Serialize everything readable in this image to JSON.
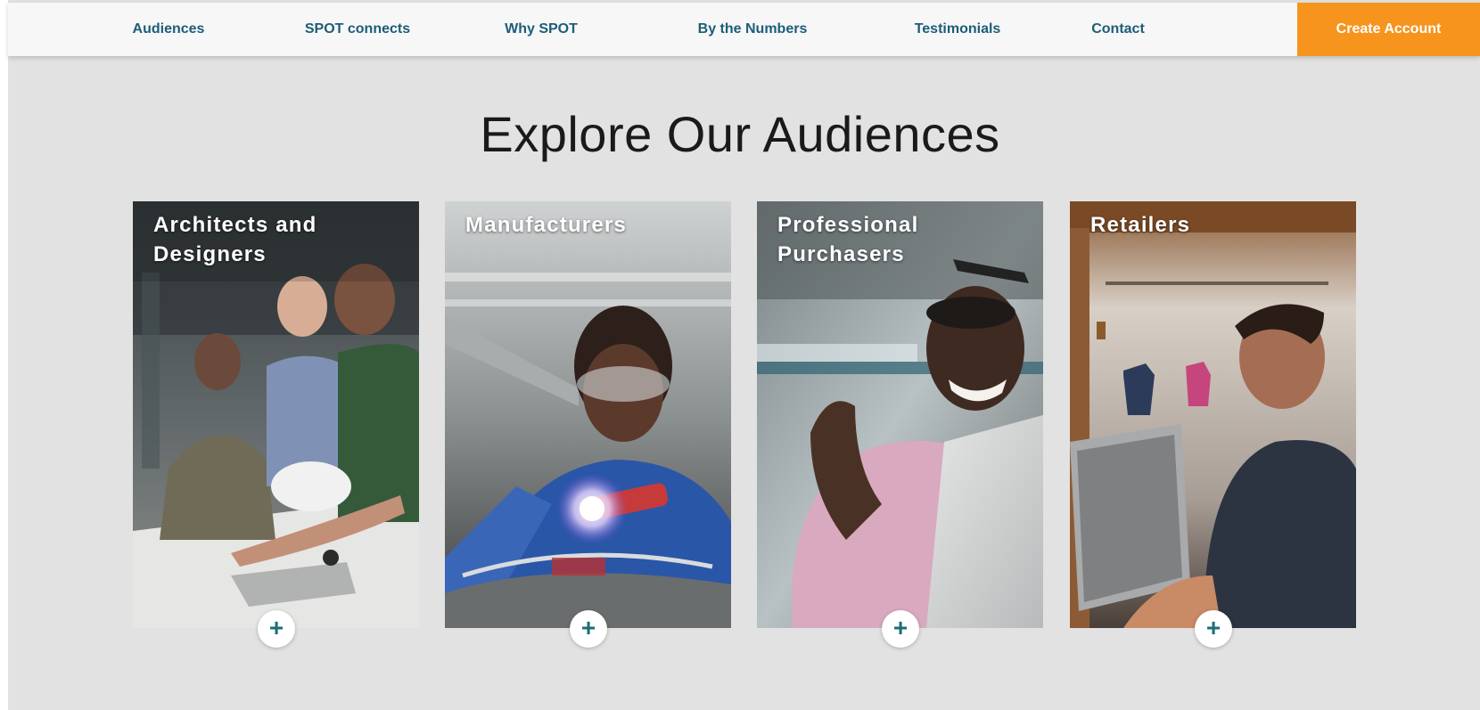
{
  "nav": {
    "items": [
      {
        "label": "Audiences"
      },
      {
        "label": "SPOT connects"
      },
      {
        "label": "Why SPOT"
      },
      {
        "label": "By the Numbers"
      },
      {
        "label": "Testimonials"
      },
      {
        "label": "Contact"
      }
    ],
    "cta_label": "Create Account"
  },
  "section": {
    "title": "Explore Our Audiences"
  },
  "cards": [
    {
      "label": "Architects and Designers",
      "expand_icon": "+"
    },
    {
      "label": "Manufacturers",
      "expand_icon": "+"
    },
    {
      "label": "Professional Purchasers",
      "expand_icon": "+"
    },
    {
      "label": "Retailers",
      "expand_icon": "+"
    }
  ],
  "colors": {
    "nav_text": "#1d5d78",
    "cta_background": "#f7941d",
    "page_background": "#e2e2e2",
    "plus_icon": "#1d6e78"
  }
}
